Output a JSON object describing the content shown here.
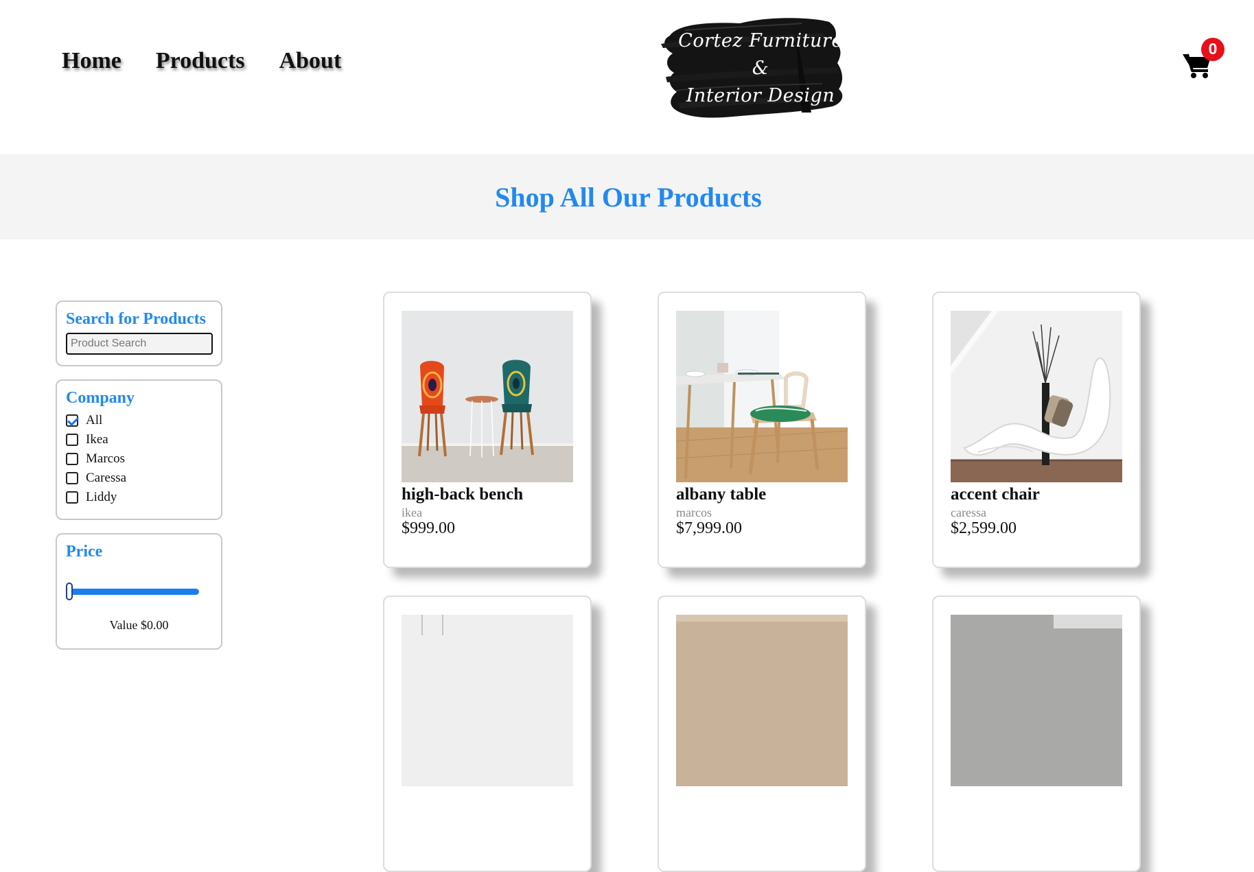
{
  "nav": {
    "items": [
      {
        "label": "Home"
      },
      {
        "label": "Products"
      },
      {
        "label": "About"
      }
    ]
  },
  "logo": {
    "line1": "Cortez Furniture",
    "line2": "&",
    "line3": "Interior Design"
  },
  "cart": {
    "count": "0",
    "icon": "cart-icon",
    "badge_color": "#e8101a"
  },
  "banner": {
    "title": "Shop All Our Products",
    "color": "#2189f0",
    "background": "#f4f4f4"
  },
  "filters": {
    "search": {
      "title": "Search for Products",
      "placeholder": "Product Search",
      "value": ""
    },
    "company": {
      "title": "Company",
      "options": [
        {
          "label": "All",
          "checked": true
        },
        {
          "label": "Ikea",
          "checked": false
        },
        {
          "label": "Marcos",
          "checked": false
        },
        {
          "label": "Caressa",
          "checked": false
        },
        {
          "label": "Liddy",
          "checked": false
        }
      ]
    },
    "price": {
      "title": "Price",
      "value_text": "Value $0.00",
      "slider_fraction": 0,
      "accent": "#1a7df0"
    }
  },
  "products": [
    {
      "name": "high-back bench",
      "company": "ikea",
      "price": "$999.00"
    },
    {
      "name": "albany table",
      "company": "marcos",
      "price": "$7,999.00"
    },
    {
      "name": "accent chair",
      "company": "caressa",
      "price": "$2,599.00"
    },
    {
      "name": "",
      "company": "",
      "price": ""
    },
    {
      "name": "",
      "company": "",
      "price": ""
    },
    {
      "name": "",
      "company": "",
      "price": ""
    }
  ]
}
